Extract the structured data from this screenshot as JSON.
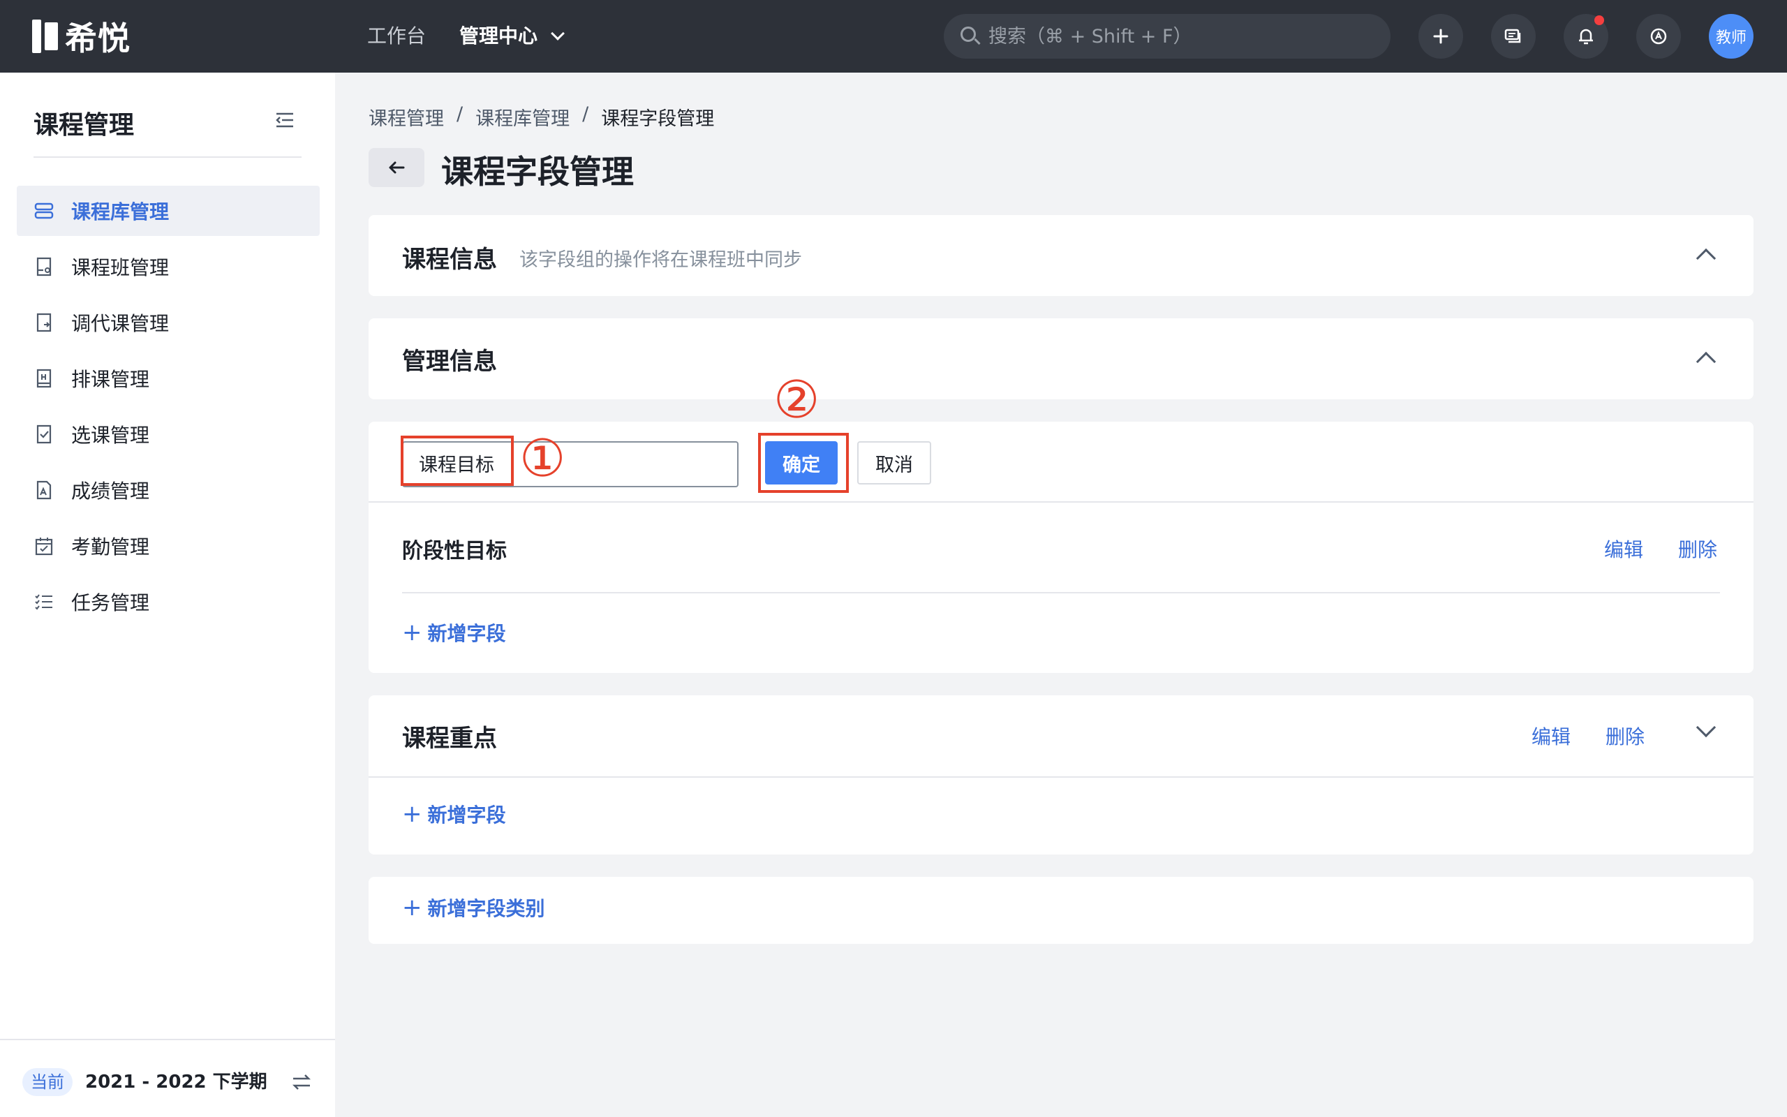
{
  "app": {
    "name": "希悦"
  },
  "topnav": {
    "items": [
      {
        "label": "工作台"
      },
      {
        "label": "管理中心"
      }
    ]
  },
  "search": {
    "placeholder": "搜索（⌘ + Shift + F）"
  },
  "user": {
    "avatar_text": "教师"
  },
  "sidebar": {
    "title": "课程管理",
    "items": [
      {
        "label": "课程库管理",
        "icon": "library-icon",
        "active": true
      },
      {
        "label": "课程班管理",
        "icon": "class-icon"
      },
      {
        "label": "调代课管理",
        "icon": "substitute-icon"
      },
      {
        "label": "排课管理",
        "icon": "schedule-icon"
      },
      {
        "label": "选课管理",
        "icon": "select-course-icon"
      },
      {
        "label": "成绩管理",
        "icon": "grade-icon"
      },
      {
        "label": "考勤管理",
        "icon": "attendance-icon"
      },
      {
        "label": "任务管理",
        "icon": "task-icon"
      }
    ],
    "term_badge": "当前",
    "term": "2021 - 2022 下学期"
  },
  "breadcrumb": [
    "课程管理",
    "课程库管理",
    "课程字段管理"
  ],
  "page": {
    "title": "课程字段管理"
  },
  "course_info": {
    "title": "课程信息",
    "subtitle": "该字段组的操作将在课程班中同步"
  },
  "manage_info": {
    "title": "管理信息"
  },
  "edit_group": {
    "input_value": "课程目标",
    "confirm_label": "确定",
    "cancel_label": "取消",
    "field_name": "阶段性目标",
    "edit_label": "编辑",
    "delete_label": "删除",
    "add_field_label": "新增字段"
  },
  "key_points": {
    "title": "课程重点",
    "edit_label": "编辑",
    "delete_label": "删除",
    "add_field_label": "新增字段"
  },
  "add_category_label": "新增字段类别",
  "annotations": {
    "step1": "①",
    "step2": "②"
  },
  "colors": {
    "accent": "#3b6fd9",
    "primary_button": "#4080f5",
    "highlight": "#e5412b",
    "topbar": "#2d3139"
  }
}
